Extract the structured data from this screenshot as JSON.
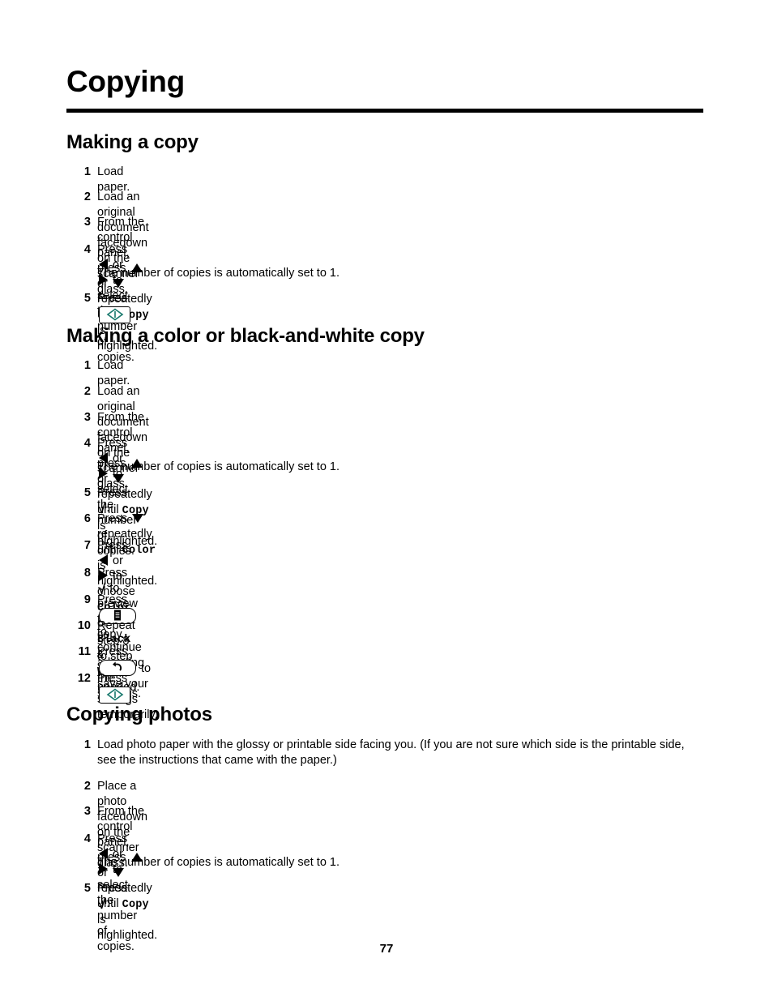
{
  "document": {
    "chapter_title": "Copying",
    "page_number": "77"
  },
  "sections": [
    {
      "heading": "Making a copy",
      "steps": [
        {
          "num": "1",
          "text": "Load paper."
        },
        {
          "num": "2",
          "text": "Load an original document facedown on the scanner glass."
        },
        {
          "num": "3",
          "text_before": "From the control panel, press ",
          "icon_a": "triangle-up-icon",
          "text_mid": " or ",
          "icon_b": "triangle-down-icon",
          "text_after": " repeatedly until ",
          "mono_term": "Copy",
          "text_end": " is highlighted."
        },
        {
          "num": "4",
          "text_before": "Press ",
          "icon_a": "triangle-left-icon",
          "text_mid": " or ",
          "icon_b": "triangle-right-icon",
          "text_after": " to select the number of copies.",
          "note": "The number of copies is automatically set to 1."
        },
        {
          "num": "5",
          "text_before": "Press ",
          "key": "start-key",
          "text_after": "."
        }
      ]
    },
    {
      "heading": "Making a color or black-and-white copy",
      "steps": [
        {
          "num": "1",
          "text": "Load paper."
        },
        {
          "num": "2",
          "text": "Load an original document facedown on the scanner glass."
        },
        {
          "num": "3",
          "text_before": "From the control panel, press ",
          "icon_a": "triangle-up-icon",
          "text_mid": " or ",
          "icon_b": "triangle-down-icon",
          "text_after": " repeatedly until ",
          "mono_term": "Copy",
          "text_end": " is highlighted."
        },
        {
          "num": "4",
          "text_before": "Press ",
          "icon_a": "triangle-left-icon",
          "text_mid": " or ",
          "icon_b": "triangle-right-icon",
          "text_after": " to select the number of copies.",
          "note": "The number of copies is automatically set to 1."
        },
        {
          "num": "5",
          "text_before": "Press ",
          "check": "√",
          "text_after": "."
        },
        {
          "num": "6",
          "text_before": "Press ",
          "icon_a": "triangle-down-icon",
          "text_after": " repeatedly until ",
          "mono_term": "Color",
          "text_end": " is highlighted."
        },
        {
          "num": "7",
          "text_before": "Press ",
          "icon_a": "triangle-left-icon",
          "text_mid": " or ",
          "icon_b": "triangle-right-icon",
          "text_after": " to choose ",
          "mono_term": "Color",
          "text_join": " or ",
          "mono_term2": "Black & White",
          "text_end": "."
        },
        {
          "num": "8",
          "text_before": "Press ",
          "check": "√",
          "text_after": " to preview the copy."
        },
        {
          "num": "9",
          "text_before": "Press ",
          "key": "menu-key",
          "text_after": " to continue adjusting the settings."
        },
        {
          "num": "10",
          "text": "Repeat step 8 to step 9 as needed."
        },
        {
          "num": "11",
          "text_before": "Press ",
          "key": "back-key",
          "text_after": " to save your settings temporarily."
        },
        {
          "num": "12",
          "text_before": "Press ",
          "key": "start-key",
          "text_after": "."
        }
      ]
    },
    {
      "heading": "Copying photos",
      "steps": [
        {
          "num": "1",
          "text": "Load photo paper with the glossy or printable side facing you. (If you are not sure which side is the printable side, see the instructions that came with the paper.)"
        },
        {
          "num": "2",
          "text": "Place a photo facedown on the scanner glass."
        },
        {
          "num": "3",
          "text_before": "From the control panel, press ",
          "icon_a": "triangle-up-icon",
          "text_mid": " or ",
          "icon_b": "triangle-down-icon",
          "text_after": " repeatedly until ",
          "mono_term": "Copy",
          "text_end": " is highlighted."
        },
        {
          "num": "4",
          "text_before": "Press ",
          "icon_a": "triangle-left-icon",
          "text_mid": " or ",
          "icon_b": "triangle-right-icon",
          "text_after": " to select the number of copies.",
          "note": "The number of copies is automatically set to 1."
        },
        {
          "num": "5",
          "text_before": "Press ",
          "check": "√",
          "text_after": "."
        }
      ]
    }
  ],
  "colors": {
    "text": "#000000",
    "background": "#ffffff",
    "start_key_accent": "#17786c"
  }
}
